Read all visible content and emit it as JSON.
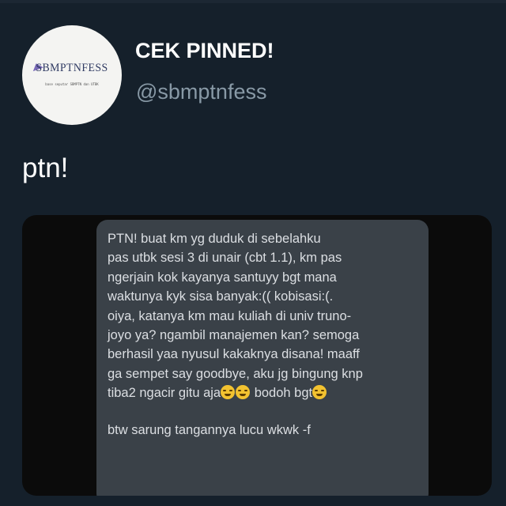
{
  "account": {
    "display_name": "CEK PINNED!",
    "handle": "@sbmptnfess",
    "avatar_title": "SBMPTNFESS",
    "avatar_subtitle": "base seputar SBMPTN dan UTBK"
  },
  "tweet": {
    "text": "ptn!"
  },
  "message": {
    "lines": [
      "PTN! buat km yg duduk di sebelahku",
      "pas utbk sesi 3 di unair (cbt 1.1), km pas",
      "ngerjain kok kayanya santuyy bgt mana",
      "waktunya kyk sisa banyak:(( kobisasi:(.",
      "oiya, katanya km mau kuliah di univ truno-",
      "joyo ya? ngambil manajemen kan? semoga",
      "berhasil yaa nyusul kakaknya disana! maaff",
      "ga sempet say goodbye, aku jg bingung knp"
    ],
    "line_emoji_before": "tiba2 ngacir gitu aja",
    "line_emoji_middle": " bodoh bgt",
    "emoji_name": "crying-laughing-emoji",
    "signoff": "btw sarung tangannya lucu wkwk -f"
  },
  "colors": {
    "background": "#15202b",
    "bubble": "#3a4148",
    "handle": "#8899a6"
  }
}
